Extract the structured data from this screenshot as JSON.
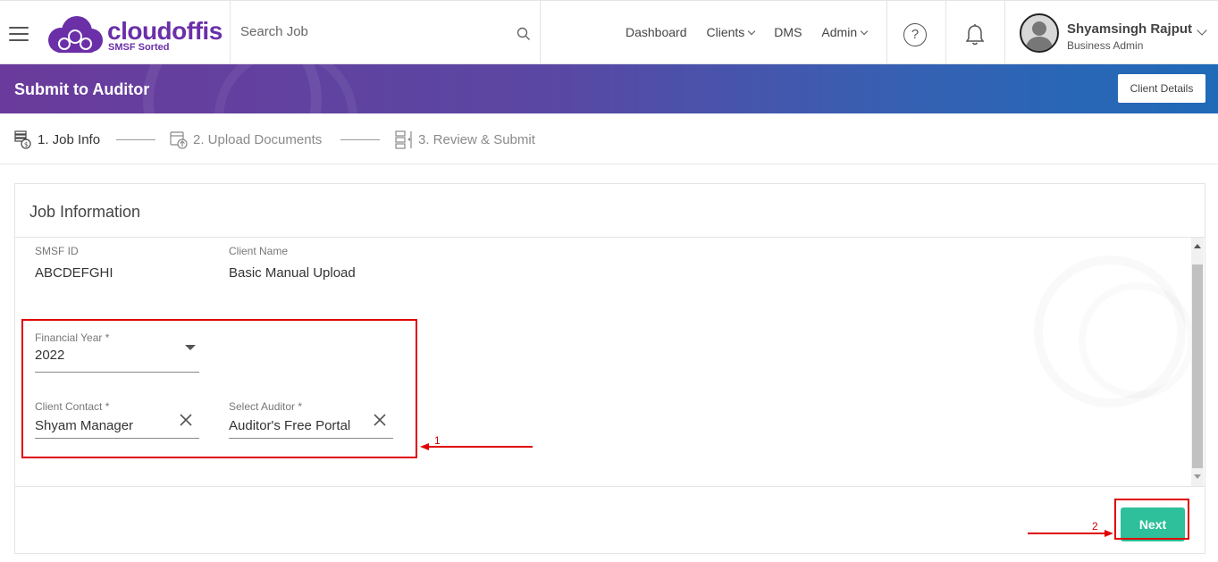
{
  "topnav": {
    "logo_text": "cloudoffis",
    "logo_subtitle": "SMSF Sorted",
    "search_placeholder": "Search Job",
    "links": [
      {
        "label": "Dashboard",
        "has_dropdown": false
      },
      {
        "label": "Clients",
        "has_dropdown": true
      },
      {
        "label": "DMS",
        "has_dropdown": false
      },
      {
        "label": "Admin",
        "has_dropdown": true
      }
    ],
    "help_symbol": "?",
    "user": {
      "name": "Shyamsingh Rajput",
      "role": "Business Admin"
    }
  },
  "banner": {
    "title": "Submit to Auditor",
    "client_details_label": "Client Details"
  },
  "stepper": {
    "steps": [
      {
        "label": "1. Job Info",
        "icon": "money-stack-icon",
        "state": "active"
      },
      {
        "label": "2. Upload Documents",
        "icon": "upload-server-icon",
        "state": "inactive"
      },
      {
        "label": "3. Review & Submit",
        "icon": "review-list-icon",
        "state": "inactive"
      }
    ]
  },
  "card": {
    "title": "Job Information",
    "fields": {
      "smsf_id": {
        "label": "SMSF ID",
        "value": "ABCDEFGHI"
      },
      "client_name": {
        "label": "Client Name",
        "value": "Basic Manual Upload"
      },
      "financial_year": {
        "label": "Financial Year *",
        "value": "2022"
      },
      "client_contact": {
        "label": "Client Contact *",
        "value": "Shyam Manager"
      },
      "select_auditor": {
        "label": "Select Auditor *",
        "value": "Auditor's Free Portal"
      }
    },
    "next_label": "Next"
  },
  "annotations": [
    {
      "number": "1",
      "color": "#e00000"
    },
    {
      "number": "2",
      "color": "#e00000"
    }
  ],
  "colors": {
    "accent_green": "#2ec09a",
    "brand_purple": "#6b2fa8",
    "banner_start": "#6a3b9c",
    "banner_end": "#1f6ab8",
    "annotation_red": "#e00000"
  }
}
